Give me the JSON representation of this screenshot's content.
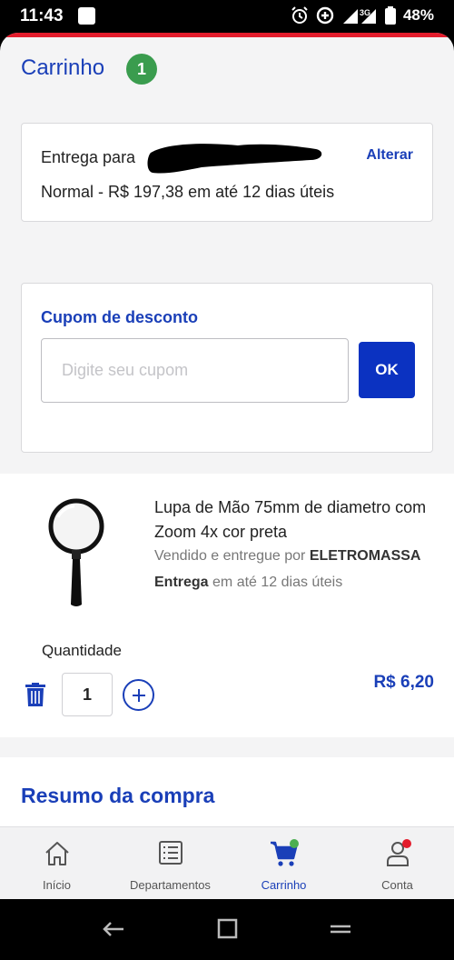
{
  "status_bar": {
    "time": "11:43",
    "network": "3G",
    "battery": "48%"
  },
  "header": {
    "title": "Carrinho",
    "count": "1"
  },
  "delivery": {
    "label": "Entrega para",
    "change_label": "Alterar",
    "detail": "Normal - R$ 197,38 em até 12 dias úteis"
  },
  "coupon": {
    "title": "Cupom de desconto",
    "placeholder": "Digite seu cupom",
    "button_label": "OK"
  },
  "product": {
    "name": "Lupa de Mão 75mm de diametro com Zoom 4x cor preta",
    "seller_prefix": "Vendido e entregue por",
    "seller": "ELETROMASSA",
    "delivery_bold": "Entrega",
    "delivery_text": "em até 12 dias úteis",
    "quantity_label": "Quantidade",
    "quantity": "1",
    "price": "R$ 6,20"
  },
  "summary": {
    "title": "Resumo da compra"
  },
  "nav": {
    "items": [
      {
        "label": "Início",
        "icon": "home-icon"
      },
      {
        "label": "Departamentos",
        "icon": "list-icon"
      },
      {
        "label": "Carrinho",
        "icon": "cart-icon"
      },
      {
        "label": "Conta",
        "icon": "user-icon"
      }
    ],
    "active": "Carrinho"
  },
  "colors": {
    "brand_blue": "#1a3fb8",
    "button_blue": "#0b32c1",
    "badge_green": "#3a9c4e",
    "accent_red": "#e31c2c"
  }
}
